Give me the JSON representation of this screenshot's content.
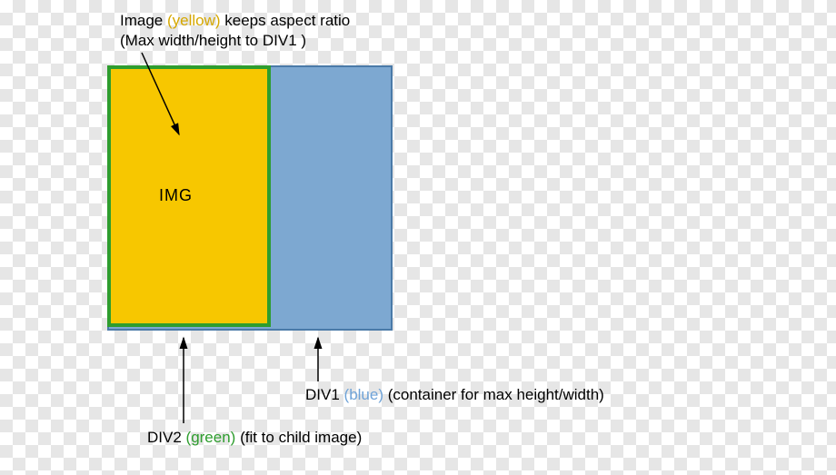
{
  "top_caption": {
    "line1_a": "Image ",
    "line1_yellow": "(yellow)",
    "line1_b": " keeps aspect ratio",
    "line2": "(Max width/height to DIV1 )"
  },
  "img_label": "IMG",
  "div1_caption": {
    "a": "DIV1 ",
    "blue": "(blue)",
    "b": " (container for max height/width)"
  },
  "div2_caption": {
    "a": "DIV2 ",
    "green": "(green)",
    "b": " (fit to child image)"
  },
  "colors": {
    "yellow": "#f7c700",
    "green": "#2e9d2e",
    "blue": "#7da8d1",
    "blue_border": "#4a7aa8"
  }
}
